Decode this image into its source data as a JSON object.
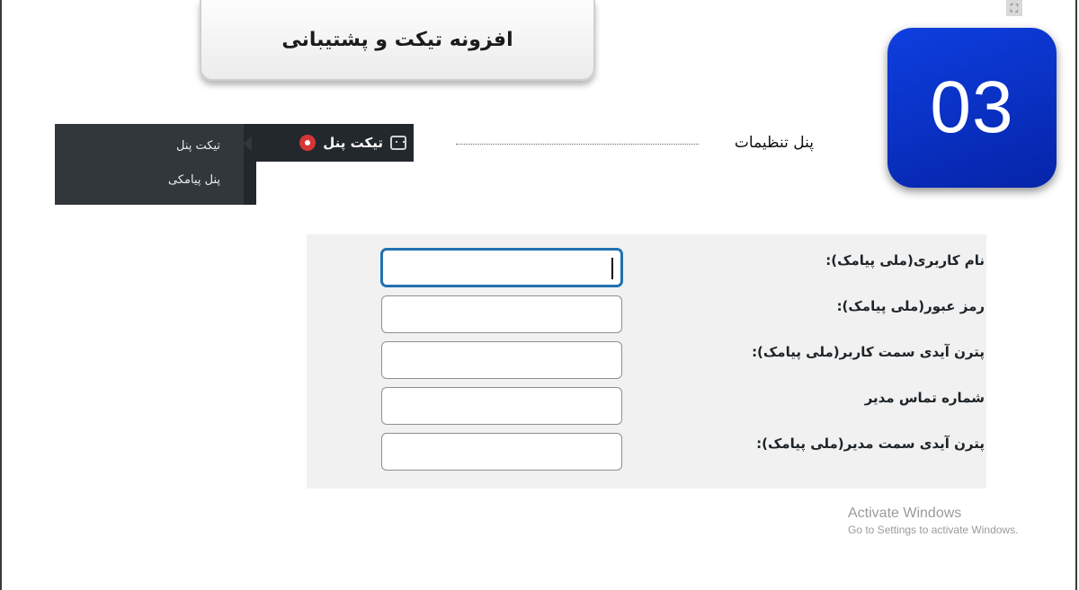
{
  "header": {
    "title": "افزونه تیکت و پشتیبانی"
  },
  "step_badge": {
    "number": "03",
    "color": "#0a33d0"
  },
  "admin_menu": {
    "main_item": {
      "label": "تیکت پنل",
      "icon": "ticket-icon",
      "notification_icon": "notification-dot-icon"
    },
    "submenu": [
      {
        "label": "تیکت پنل"
      },
      {
        "label": "پنل پیامکی"
      }
    ]
  },
  "callout": {
    "label": "پنل تنظیمات"
  },
  "form": {
    "fields": [
      {
        "label": "نام کاربری(ملی پیامک):",
        "value": "",
        "focused": true
      },
      {
        "label": "رمز عبور(ملی پیامک):",
        "value": ""
      },
      {
        "label": "پترن آیدی سمت کاربر(ملی پیامک):",
        "value": ""
      },
      {
        "label": "شماره تماس مدیر",
        "value": ""
      },
      {
        "label": "پترن آیدی سمت مدیر(ملی پیامک):",
        "value": ""
      }
    ]
  },
  "watermark": {
    "title": "Activate Windows",
    "subtitle": "Go to Settings to activate Windows."
  }
}
